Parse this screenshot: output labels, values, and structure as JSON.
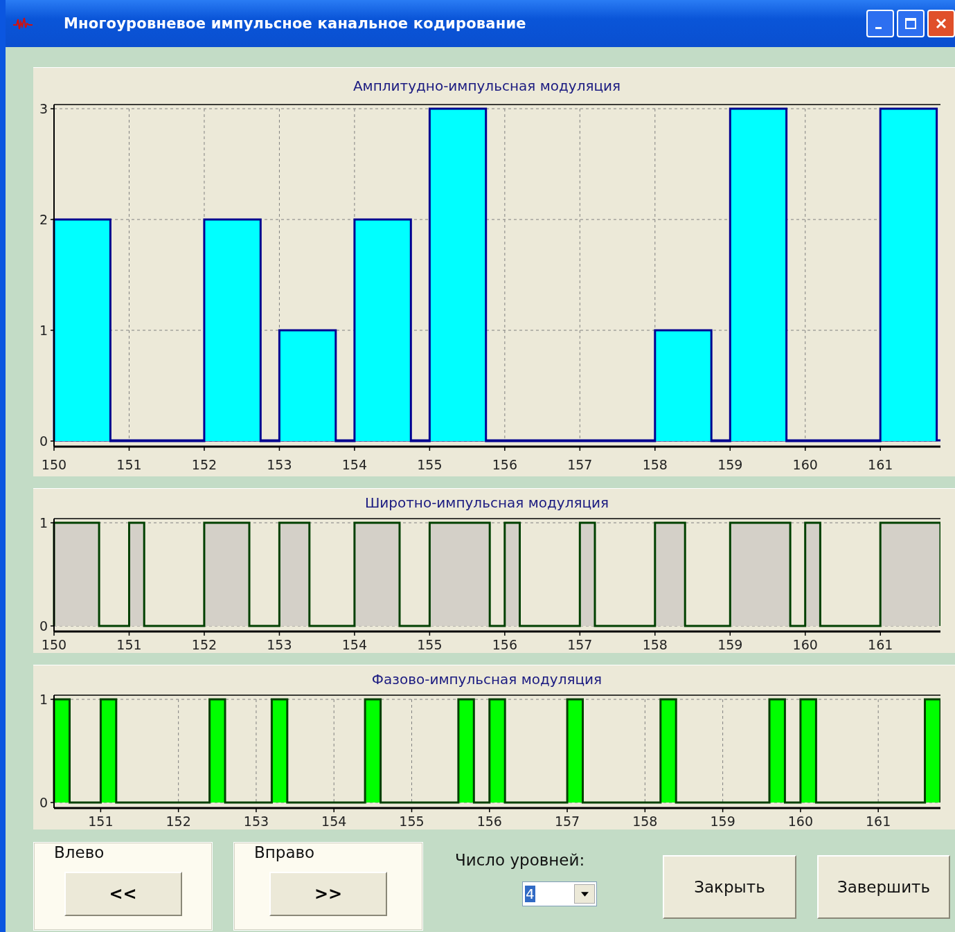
{
  "window": {
    "title": "Многоуровневое импульсное канальное кодирование"
  },
  "charts": [
    {
      "chart_data": {
        "type": "area",
        "title": "Амплитудно-импульсная модуляция",
        "grid": true,
        "x": [
          150,
          150,
          150.75,
          150.75,
          152,
          152,
          152.75,
          152.75,
          153,
          153,
          153.75,
          153.75,
          154,
          154,
          154.75,
          154.75,
          155,
          155,
          155.75,
          155.75,
          158,
          158,
          158.75,
          158.75,
          159,
          159,
          159.75,
          159.75,
          161,
          161,
          161.75,
          161.75
        ],
        "series": [
          {
            "color": "#00ffff",
            "values": [
              0,
              2,
              2,
              0,
              0,
              2,
              2,
              0,
              0,
              1,
              1,
              0,
              0,
              2,
              2,
              0,
              0,
              3,
              3,
              0,
              0,
              1,
              1,
              0,
              0,
              3,
              3,
              0,
              0,
              3,
              3,
              0
            ]
          }
        ],
        "xlim": [
          150,
          161.8
        ],
        "ylim": [
          0,
          3
        ],
        "xticks": [
          150,
          151,
          152,
          153,
          154,
          155,
          156,
          157,
          158,
          159,
          160,
          161
        ],
        "yticks": [
          0,
          1,
          2,
          3
        ]
      }
    },
    {
      "chart_data": {
        "type": "area",
        "title": "Широтно-импульсная модуляция",
        "grid": true,
        "x": [
          150,
          150,
          150.6,
          150.6,
          151,
          151,
          151.2,
          151.2,
          152,
          152,
          152.6,
          152.6,
          153,
          153,
          153.4,
          153.4,
          154,
          154,
          154.6,
          154.6,
          155,
          155,
          155.8,
          155.8,
          156,
          156,
          156.2,
          156.2,
          157,
          157,
          157.2,
          157.2,
          158,
          158,
          158.4,
          158.4,
          159,
          159,
          159.8,
          159.8,
          160,
          160,
          160.2,
          160.2,
          161,
          161,
          161.8,
          161.8
        ],
        "series": [
          {
            "color": "#d4d0c8",
            "values": [
              0,
              1,
              1,
              0,
              0,
              1,
              1,
              0,
              0,
              1,
              1,
              0,
              0,
              1,
              1,
              0,
              0,
              1,
              1,
              0,
              0,
              1,
              1,
              0,
              0,
              1,
              1,
              0,
              0,
              1,
              1,
              0,
              0,
              1,
              1,
              0,
              0,
              1,
              1,
              0,
              0,
              1,
              1,
              0,
              0,
              1,
              1,
              0
            ]
          }
        ],
        "xlim": [
          150,
          161.8
        ],
        "ylim": [
          0,
          1
        ],
        "xticks": [
          150,
          151,
          152,
          153,
          154,
          155,
          156,
          157,
          158,
          159,
          160,
          161
        ],
        "yticks": [
          0,
          1
        ]
      }
    },
    {
      "chart_data": {
        "type": "area",
        "title": "Фазово-импульсная модуляция",
        "grid": true,
        "x": [
          150.4,
          150.4,
          150.6,
          150.6,
          151,
          151,
          151.2,
          151.2,
          152.4,
          152.4,
          152.6,
          152.6,
          153.2,
          153.2,
          153.4,
          153.4,
          154.4,
          154.4,
          154.6,
          154.6,
          155.6,
          155.6,
          155.8,
          155.8,
          156,
          156,
          156.2,
          156.2,
          157,
          157,
          157.2,
          157.2,
          158.2,
          158.2,
          158.4,
          158.4,
          159.6,
          159.6,
          159.8,
          159.8,
          160,
          160,
          160.2,
          160.2,
          161.6,
          161.6,
          161.8,
          161.8
        ],
        "series": [
          {
            "color": "#00ff00",
            "values": [
              0,
              1,
              1,
              0,
              0,
              1,
              1,
              0,
              0,
              1,
              1,
              0,
              0,
              1,
              1,
              0,
              0,
              1,
              1,
              0,
              0,
              1,
              1,
              0,
              0,
              1,
              1,
              0,
              0,
              1,
              1,
              0,
              0,
              1,
              1,
              0,
              0,
              1,
              1,
              0,
              0,
              1,
              1,
              0,
              0,
              1,
              1,
              0
            ]
          }
        ],
        "xlim": [
          150.4,
          161.8
        ],
        "ylim": [
          0,
          1
        ],
        "xticks": [
          151,
          152,
          153,
          154,
          155,
          156,
          157,
          158,
          159,
          160,
          161
        ],
        "yticks": [
          0,
          1
        ]
      }
    }
  ],
  "controls": {
    "groups": [
      {
        "label": "Влево",
        "button": "<<"
      },
      {
        "label": "Вправо",
        "button": ">>"
      }
    ],
    "levels": {
      "label": "Число уровней:",
      "value": "4"
    },
    "buttons": [
      "Закрыть",
      "Завершить"
    ]
  }
}
